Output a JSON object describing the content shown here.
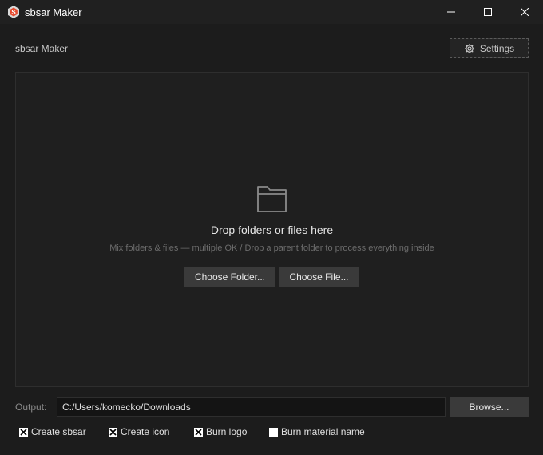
{
  "window": {
    "title": "sbsar Maker",
    "controls": {
      "minimize": "minimize-icon",
      "maximize": "maximize-icon",
      "close": "close-icon"
    }
  },
  "header": {
    "label": "sbsar Maker",
    "settings_label": "Settings",
    "settings_icon": "gear-icon"
  },
  "dropzone": {
    "icon": "folder-icon",
    "title": "Drop folders or files here",
    "subtitle": "Mix folders & files — multiple OK / Drop a parent folder to process everything inside",
    "choose_folder_label": "Choose Folder...",
    "choose_file_label": "Choose File..."
  },
  "output": {
    "label": "Output:",
    "path": "C:/Users/komecko/Downloads",
    "browse_label": "Browse..."
  },
  "options": [
    {
      "label": "Create sbsar",
      "checked": true
    },
    {
      "label": "Create icon",
      "checked": true
    },
    {
      "label": "Burn logo",
      "checked": true
    },
    {
      "label": "Burn material name",
      "checked": false
    }
  ],
  "colors": {
    "background": "#1c1c1c",
    "titlebar": "#202020",
    "button": "#3a3a3a",
    "input": "#141414"
  }
}
